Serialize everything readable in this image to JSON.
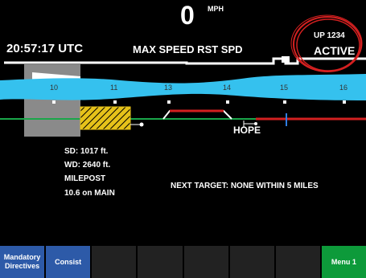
{
  "header": {
    "speed": "0",
    "speed_unit": "MPH",
    "clock": "20:57:17 UTC",
    "speed_mode": "MAX SPEED RST SPD",
    "train_id": "UP 1234",
    "train_status": "ACTIVE"
  },
  "track": {
    "mileposts": [
      "10",
      "11",
      "13",
      "14",
      "15",
      "16"
    ],
    "station": "HOPE"
  },
  "info": {
    "sd": "SD:  1017 ft.",
    "wd": "WD:  2640 ft.",
    "milepost_label": "MILEPOST",
    "milepost_value": "10.6 on MAIN",
    "next_target": "NEXT TARGET: NONE WITHIN 5 MILES"
  },
  "softkeys": [
    {
      "label": "Mandatory Directives",
      "color": "#2d5aa8"
    },
    {
      "label": "Consist",
      "color": "#2d5aa8"
    },
    {
      "label": "",
      "color": "#222222"
    },
    {
      "label": "",
      "color": "#222222"
    },
    {
      "label": "",
      "color": "#222222"
    },
    {
      "label": "",
      "color": "#222222"
    },
    {
      "label": "",
      "color": "#222222"
    },
    {
      "label": "Menu 1",
      "color": "#0d9a3a"
    }
  ],
  "colors": {
    "track_green": "#1aa64a",
    "track_red": "#d42020",
    "water": "#35c1ee",
    "status_circle": "#d42020"
  }
}
